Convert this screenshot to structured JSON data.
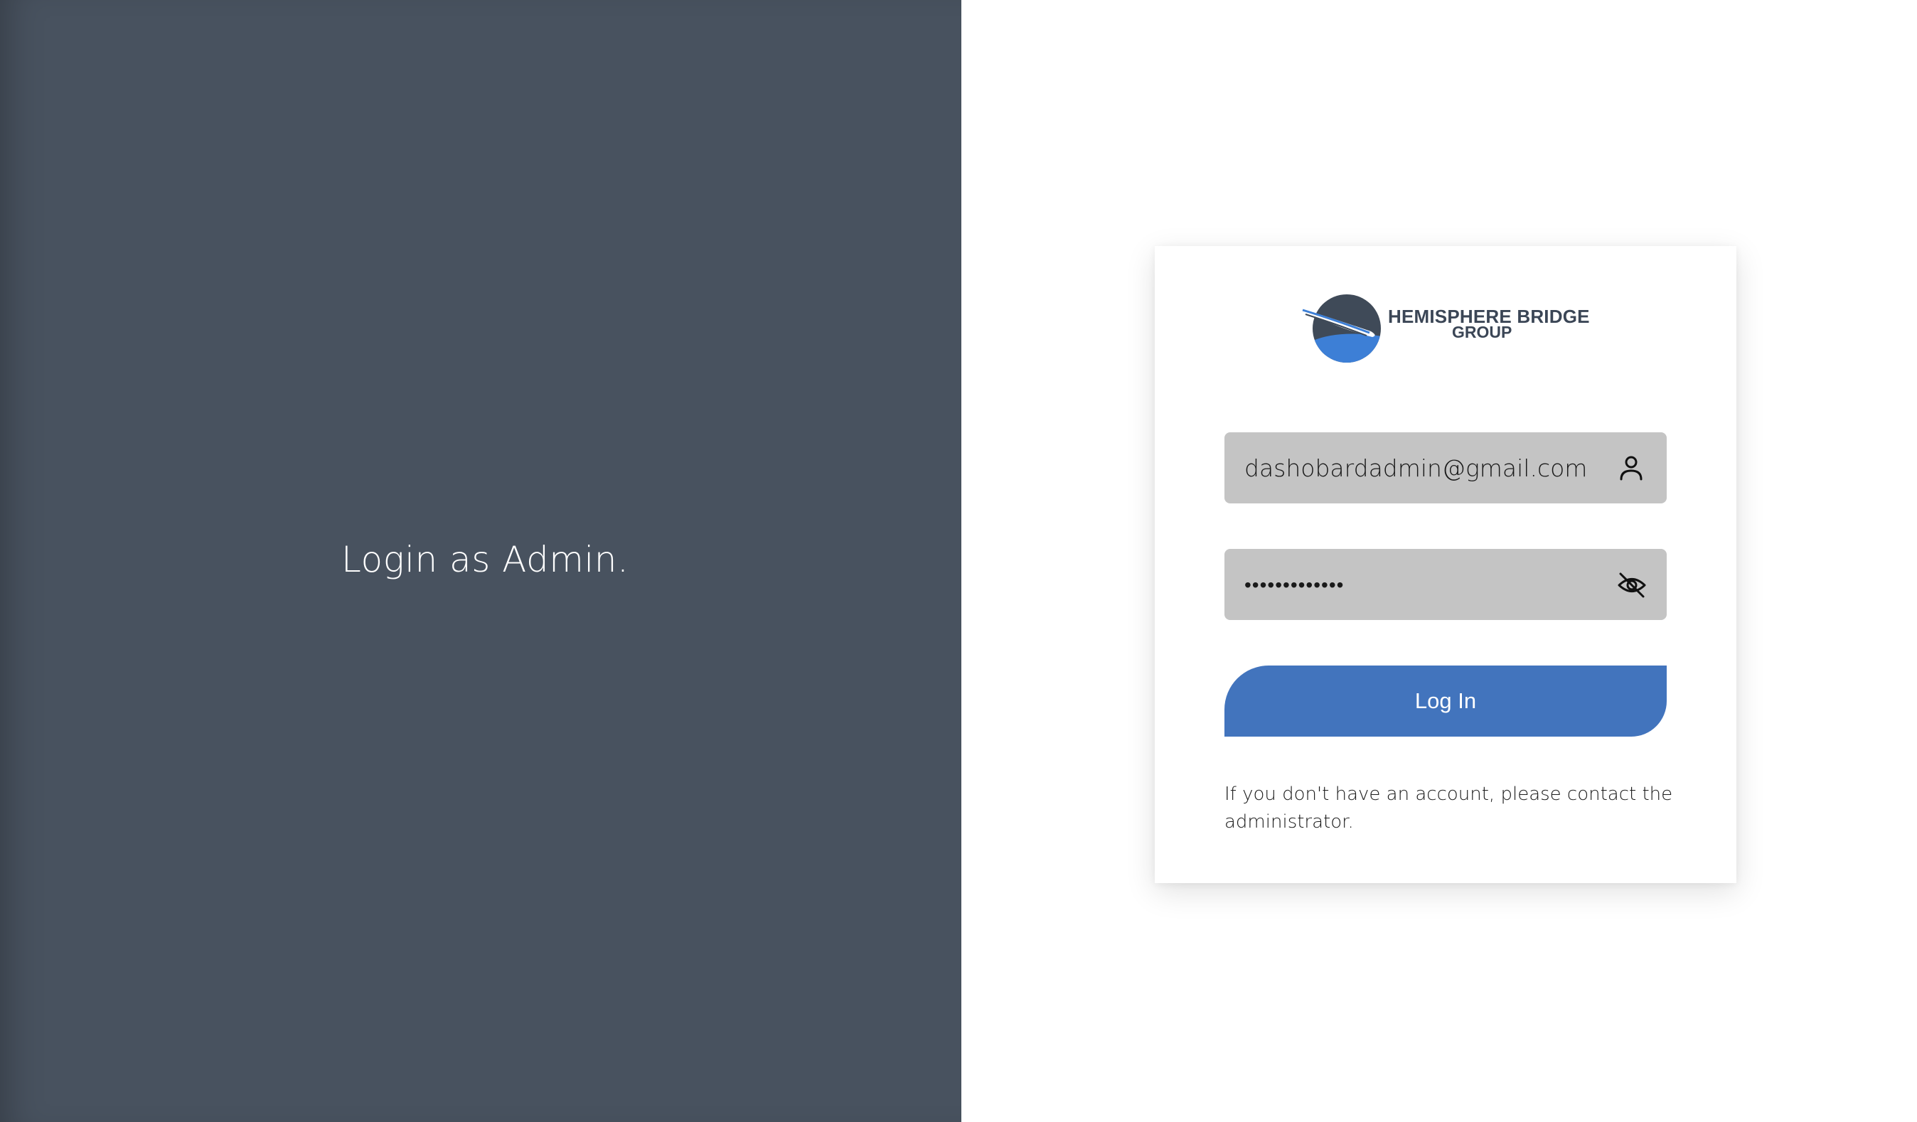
{
  "left_panel": {
    "title": "Login as Admin."
  },
  "logo": {
    "line1": "HEMISPHERE BRIDGE",
    "line2": "GROUP",
    "icon": "globe-swoosh-logo"
  },
  "form": {
    "email": {
      "value": "dashobardadmin@gmail.com",
      "icon": "user-icon"
    },
    "password": {
      "value": "•••••••••••••",
      "icon": "eye-off-icon"
    },
    "login_button": "Log In",
    "note": "If you don't have an account, please contact the administrator."
  },
  "colors": {
    "left_bg": "#48525f",
    "accent": "#4274bd",
    "field_bg": "#c4c4c4",
    "logo_text": "#3b4656"
  }
}
